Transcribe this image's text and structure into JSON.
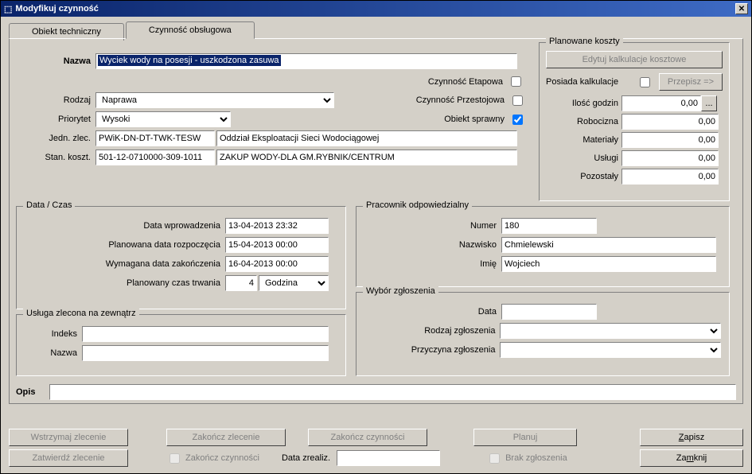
{
  "window": {
    "title": "Modyfikuj czynność"
  },
  "tabs": {
    "tab1": "Obiekt techniczny",
    "tab2": "Czynność obsługowa"
  },
  "main": {
    "name_label": "Nazwa",
    "name_value": "Wyciek wody na posesji - uszkodzona zasuwa",
    "stage_label": "Czynność Etapowa",
    "idle_label": "Czynność Przestojowa",
    "obj_ok_label": "Obiekt sprawny",
    "kind_label": "Rodzaj",
    "kind_value": "Naprawa",
    "priority_label": "Priorytet",
    "priority_value": "Wysoki",
    "unit_label": "Jedn. zlec.",
    "unit_code": "PWiK-DN-DT-TWK-TESW",
    "unit_name": "Oddział Eksploatacji Sieci Wodociągowej",
    "cost_label": "Stan. koszt.",
    "cost_code": "501-12-0710000-309-1011",
    "cost_name": "ZAKUP WODY-DLA GM.RYBNIK/CENTRUM"
  },
  "costs": {
    "legend": "Planowane koszty",
    "edit_btn": "Edytuj kalkulacje kosztowe",
    "has_calc_label": "Posiada kalkulacje",
    "assign_btn": "Przepisz =>",
    "hours_label": "Ilość godzin",
    "hours": "0,00",
    "labor_label": "Robocizna",
    "labor": "0,00",
    "materials_label": "Materiały",
    "materials": "0,00",
    "services_label": "Usługi",
    "services": "0,00",
    "other_label": "Pozostały",
    "other": "0,00"
  },
  "dates": {
    "legend": "Data / Czas",
    "entered_label": "Data wprowadzenia",
    "entered": "13-04-2013 23:32",
    "start_label": "Planowana data rozpoczęcia",
    "start": "15-04-2013 00:00",
    "end_label": "Wymagana data zakończenia",
    "end": "16-04-2013 00:00",
    "duration_label": "Planowany czas trwania",
    "duration": "4",
    "unit": "Godzina"
  },
  "external": {
    "legend": "Usługa zlecona na zewnątrz",
    "index_label": "Indeks",
    "index": "",
    "name_label": "Nazwa",
    "name": ""
  },
  "worker": {
    "legend": "Pracownik odpowiedzialny",
    "num_label": "Numer",
    "num": "180",
    "surname_label": "Nazwisko",
    "surname": "Chmielewski",
    "firstname_label": "Imię",
    "firstname": "Wojciech"
  },
  "report": {
    "legend": "Wybór zgłoszenia",
    "date_label": "Data",
    "date": "",
    "kind_label": "Rodzaj zgłoszenia",
    "kind": "",
    "cause_label": "Przyczyna zgłoszenia",
    "cause": ""
  },
  "desc": {
    "label": "Opis",
    "value": ""
  },
  "buttons": {
    "hold": "Wstrzymaj zlecenie",
    "approve": "Zatwierdź zlecenie",
    "finish_order": "Zakończ zlecenie",
    "finish_acts_cb": "Zakończ czynności",
    "finish_acts_btn": "Zakończ czynności",
    "date_real_label": "Data zrealiz.",
    "plan": "Planuj",
    "no_report": "Brak zgłoszenia",
    "save": "Zapisz",
    "close": "Zamknij"
  }
}
